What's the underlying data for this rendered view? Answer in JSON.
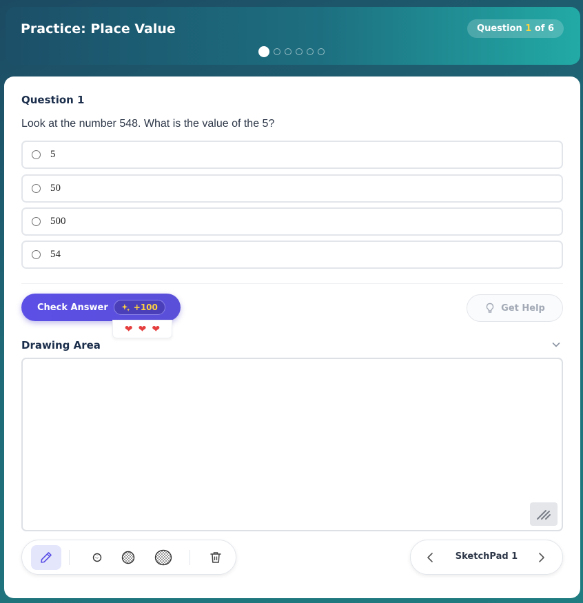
{
  "header": {
    "title": "Practice: Place Value",
    "counter_prefix": "Question ",
    "counter_current": "1",
    "counter_suffix": " of 6",
    "total_dots": 6,
    "active_dot": 1
  },
  "question": {
    "heading": "Question 1",
    "text": "Look at the number 548. What is the value of the 5?",
    "options": [
      {
        "label": "5"
      },
      {
        "label": "50"
      },
      {
        "label": "500"
      },
      {
        "label": "54"
      }
    ]
  },
  "actions": {
    "check_label": "Check Answer",
    "xp_icon": "sparkles-icon",
    "xp_label": "+100",
    "hearts": 3,
    "help_label": "Get Help",
    "help_icon": "lightbulb-icon"
  },
  "drawing": {
    "heading": "Drawing Area",
    "collapse_icon": "chevron-down-icon",
    "tools": [
      "pencil-icon",
      "eraser-small-icon",
      "eraser-medium-icon",
      "eraser-large-icon",
      "trash-icon"
    ],
    "active_tool": "pencil-icon",
    "pager_label": "SketchPad 1"
  },
  "colors": {
    "accent": "#5b4fe6",
    "heading": "#1b2e4b",
    "highlight": "#ffd23f",
    "heart": "#e53e3e"
  }
}
